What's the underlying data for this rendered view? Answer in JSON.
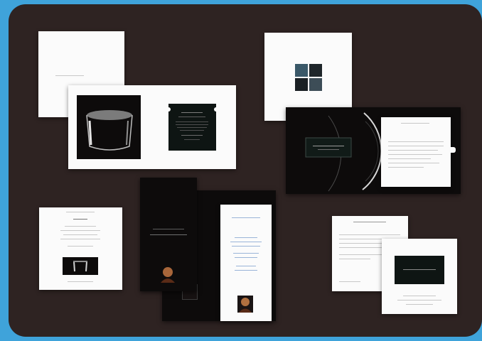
{
  "scene": {
    "description_items": [
      "stationery-suite"
    ]
  },
  "colors": {
    "frame": "#3fa3da",
    "board": "#2e2322",
    "paper": "#fbfbfb",
    "ink": "#0d0b0b",
    "teal_card": "#0e1513"
  },
  "pieces": {
    "card_a": {
      "icon": "title-card"
    },
    "folder_b": {
      "icon": "stool-photo-folder"
    },
    "card_c": {
      "icon": "photo-grid-card"
    },
    "folder_d": {
      "icon": "disc-letter-folder"
    },
    "card_e": {
      "icon": "invitation-card"
    },
    "folder_f": {
      "icon": "tall-booklet"
    },
    "folder_g": {
      "icon": "letter-and-card"
    }
  }
}
